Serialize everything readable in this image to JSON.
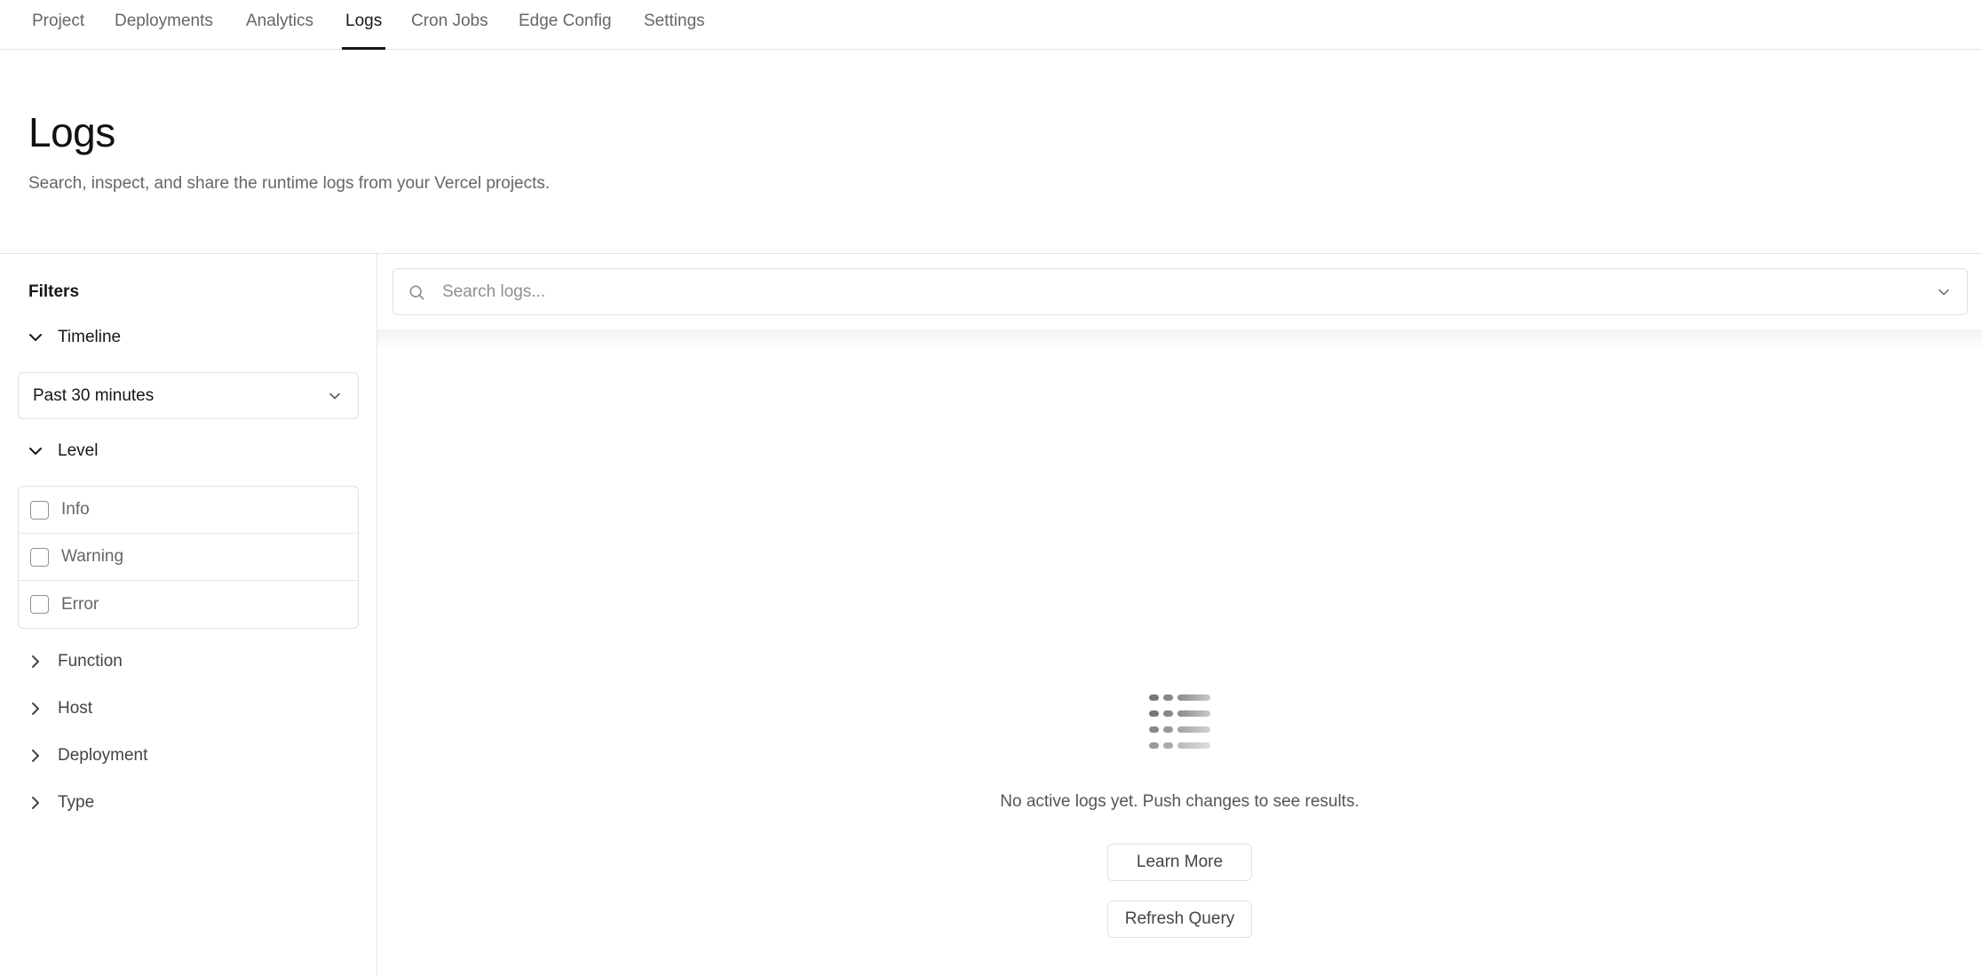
{
  "nav": {
    "tabs": [
      {
        "label": "Project"
      },
      {
        "label": "Deployments"
      },
      {
        "label": "Analytics"
      },
      {
        "label": "Logs"
      },
      {
        "label": "Cron Jobs"
      },
      {
        "label": "Edge Config"
      },
      {
        "label": "Settings"
      }
    ],
    "active": "Logs"
  },
  "header": {
    "title": "Logs",
    "subtitle": "Search, inspect, and share the runtime logs from your Vercel projects."
  },
  "sidebar": {
    "title": "Filters",
    "timeline": {
      "label": "Timeline",
      "selected": "Past 30 minutes"
    },
    "level": {
      "label": "Level",
      "options": [
        {
          "label": "Info",
          "checked": false
        },
        {
          "label": "Warning",
          "checked": false
        },
        {
          "label": "Error",
          "checked": false
        }
      ]
    },
    "collapsed_sections": [
      {
        "label": "Function"
      },
      {
        "label": "Host"
      },
      {
        "label": "Deployment"
      },
      {
        "label": "Type"
      }
    ]
  },
  "search": {
    "placeholder": "Search logs...",
    "value": ""
  },
  "empty_state": {
    "icon": "list-icon",
    "message": "No active logs yet. Push changes to see results.",
    "learn_more_label": "Learn More",
    "refresh_label": "Refresh Query"
  },
  "colors": {
    "text_primary": "#171717",
    "text_secondary": "#666666",
    "border": "#e5e5e5",
    "active_underline": "#171717"
  }
}
